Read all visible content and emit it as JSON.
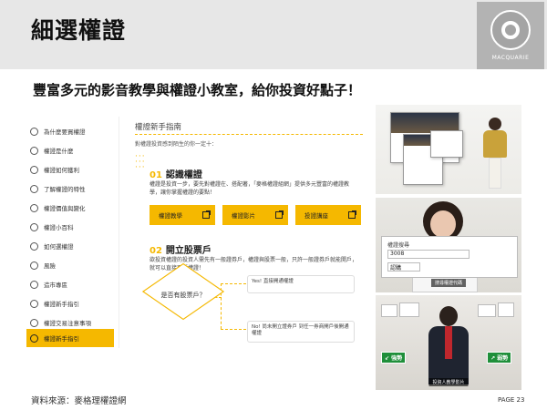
{
  "slide": {
    "title": "細選權證",
    "subtitle": "豐富多元的影音教學與權證小教室，給你投資好點子！",
    "logo_text": "MACQUARIE",
    "source": "資料來源：麥格理權證網",
    "page": "PAGE 23"
  },
  "menu": {
    "items": [
      {
        "label": "為什麼要買權證"
      },
      {
        "label": "權證是什麼"
      },
      {
        "label": "權證如何獲利"
      },
      {
        "label": "了解權證的特性"
      },
      {
        "label": "權證價值與變化"
      },
      {
        "label": "權證小百科"
      },
      {
        "label": "如何選權證"
      },
      {
        "label": "風險"
      },
      {
        "label": "造市專區"
      },
      {
        "label": "權證新手指引"
      },
      {
        "label": "權證交易注意事項"
      },
      {
        "label": "權證新手指引"
      }
    ],
    "active_index": 11
  },
  "content": {
    "heading": "權證新手指南",
    "intro": "對權證投資感到陌生的你一定十：",
    "step1": {
      "num": "01",
      "title": "認識權證",
      "desc": "權證是投資一步，要先對權證在、搭配著，「麥格權證組網」提供多元豐富的權證教學，讓你掌握權證的要點！"
    },
    "buttons": [
      {
        "label": "權證教學"
      },
      {
        "label": "權證影片"
      },
      {
        "label": "投證講座"
      }
    ],
    "step2": {
      "num": "02",
      "title": "開立股票戶",
      "desc": "欲投資權證的投資人需先有一般證券戶，權證與股票一般，只許一般證券戶就能開戶，就可以直接買賣權證！"
    },
    "decision": "是否有股票戶？",
    "yes_box": "Yes! 直接開通權證",
    "no_box": "No! 尚未開立證券戶 到任一券商開戶後開通權證"
  },
  "images": {
    "caption2": "搜尋權證代碼",
    "caption3": "投資人教學影片",
    "tag_left": "↙ 強勢",
    "tag_right": "↗ 弱勢",
    "card2_title": "權證搜尋",
    "card2_code": "3008",
    "card2_opt": "認購"
  },
  "colors": {
    "accent": "#f5b800",
    "header_bg": "#e7e7e7",
    "logo_bg": "#b3b3b3"
  }
}
